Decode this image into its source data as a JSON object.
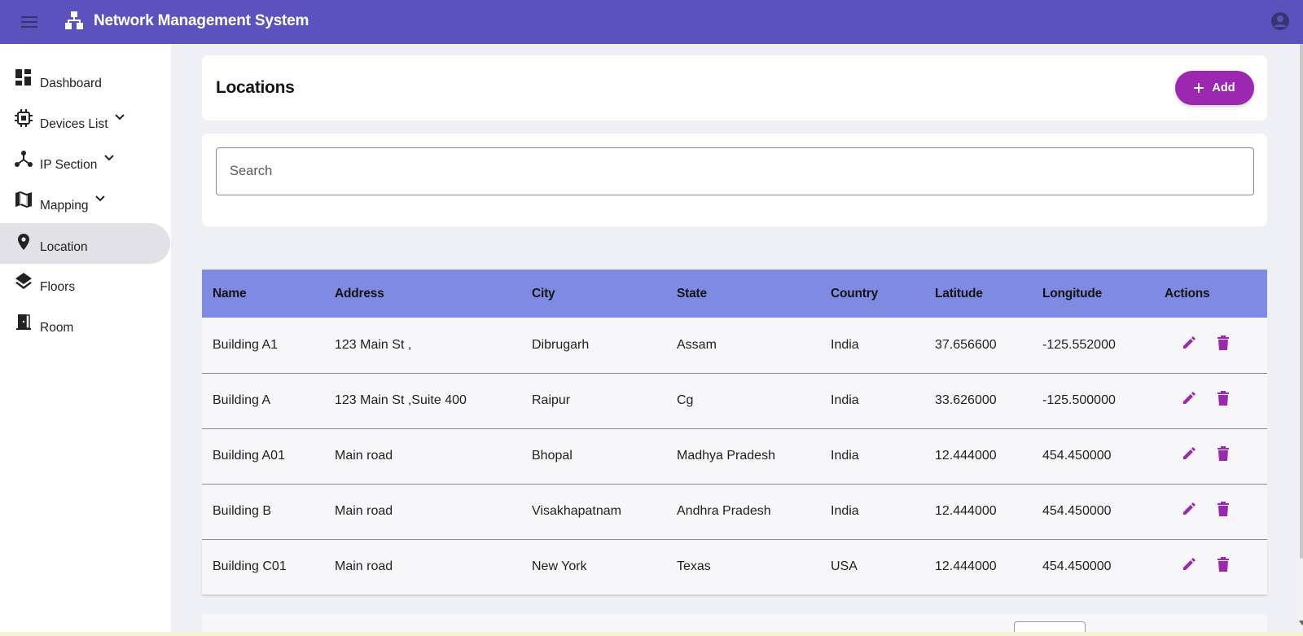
{
  "app": {
    "title": "Network Management System",
    "brand_color": "#5c52bd",
    "accent_color": "#9c27b0"
  },
  "topbar": {
    "menu_icon": "hamburger-menu-icon",
    "logo_icon": "network-hierarchy-icon",
    "account_icon": "account-circle-icon"
  },
  "sidebar": {
    "items": [
      {
        "label": "Dashboard",
        "icon": "dashboard-icon",
        "expandable": false,
        "active": false
      },
      {
        "label": "Devices List",
        "icon": "chip-icon",
        "expandable": true,
        "active": false
      },
      {
        "label": "IP Section",
        "icon": "hub-icon",
        "expandable": true,
        "active": false
      },
      {
        "label": "Mapping",
        "icon": "map-icon",
        "expandable": true,
        "active": false
      },
      {
        "label": "Location",
        "icon": "location-pin-icon",
        "expandable": false,
        "active": true
      },
      {
        "label": "Floors",
        "icon": "layers-icon",
        "expandable": false,
        "active": false
      },
      {
        "label": "Room",
        "icon": "door-icon",
        "expandable": false,
        "active": false
      }
    ]
  },
  "main": {
    "title": "Locations",
    "add_button_label": "Add",
    "search_placeholder": "Search"
  },
  "table": {
    "columns": [
      "Name",
      "Address",
      "City",
      "State",
      "Country",
      "Latitude",
      "Longitude",
      "Actions"
    ],
    "rows": [
      [
        "Building A1",
        "123 Main St ,",
        "Dibrugarh",
        "Assam",
        "India",
        "37.656600",
        "-125.552000"
      ],
      [
        "Building A",
        "123 Main St ,Suite 400",
        "Raipur",
        "Cg",
        "India",
        "33.626000",
        "-125.500000"
      ],
      [
        "Building A01",
        "Main road",
        "Bhopal",
        "Madhya Pradesh",
        "India",
        "12.444000",
        "454.450000"
      ],
      [
        "Building B",
        "Main road",
        "Visakhapatnam",
        "Andhra Pradesh",
        "India",
        "12.444000",
        "454.450000"
      ],
      [
        "Building C01",
        "Main road",
        "New York",
        "Texas",
        "USA",
        "12.444000",
        "454.450000"
      ]
    ],
    "header_color": "#7f8be3",
    "action_icons": [
      "edit-icon",
      "delete-icon"
    ]
  }
}
